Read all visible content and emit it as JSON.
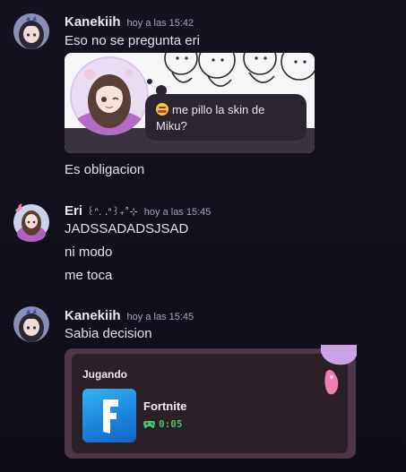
{
  "messages": [
    {
      "username": "Kanekiih",
      "timestamp": "hoy a las 15:42",
      "lines": [
        "Eso no se pregunta eri",
        "Es obligacion"
      ],
      "embed": {
        "status_text": "me pillo la skin de Miku?"
      }
    },
    {
      "username": "Eri",
      "decoration": "꒰ᐢ. .ᐢ꒱₊˚⊹",
      "timestamp": "hoy a las 15:45",
      "lines": [
        "JADSSADADSJSAD",
        "ni modo",
        "me toca"
      ]
    },
    {
      "username": "Kanekiih",
      "timestamp": "hoy a las 15:45",
      "lines": [
        "Sabia decision"
      ],
      "activity": {
        "label": "Jugando",
        "game_name": "Fortnite",
        "elapsed": "0:05"
      }
    }
  ],
  "colors": {
    "background": "#15121f",
    "username": "#ece8f5",
    "timestamp": "#a8a2b8",
    "activity_card": "#4e3748",
    "elapsed_green": "#4cc46a",
    "dnd_red": "#e0454f"
  },
  "icons": {
    "avatar_kanekiih": "anime-girl-avatar",
    "avatar_eri": "anime-girl-avatar",
    "status_badge": "do-not-disturb-icon",
    "gamepad": "gamepad-icon",
    "game_icon": "fortnite-icon"
  }
}
